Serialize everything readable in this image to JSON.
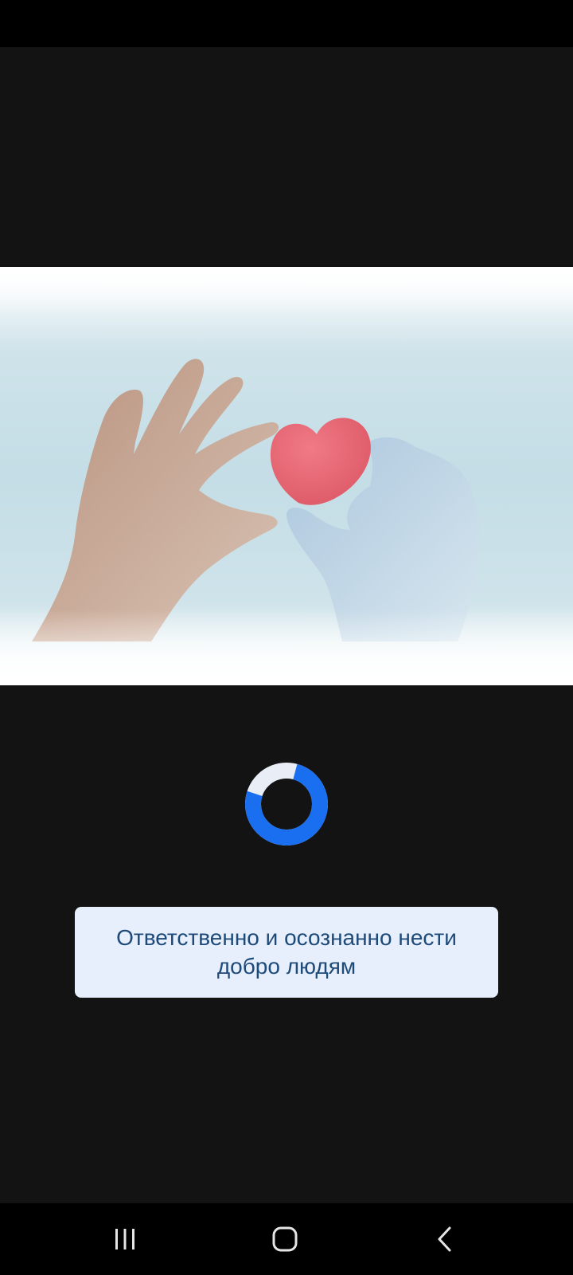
{
  "status_bar": {},
  "hero": {
    "image_name": "hands-holding-heart-image"
  },
  "loading": {
    "spinner_color": "#1a6ef0",
    "track_color": "#e8edf6"
  },
  "message": {
    "text": "Ответственно и осознанно нести добро людям"
  },
  "navigation": {
    "buttons": [
      {
        "icon": "recent-apps-icon"
      },
      {
        "icon": "home-icon"
      },
      {
        "icon": "back-icon"
      }
    ]
  },
  "colors": {
    "background": "#131313",
    "card_background": "#e6effb",
    "card_text": "#1e4a7a"
  }
}
